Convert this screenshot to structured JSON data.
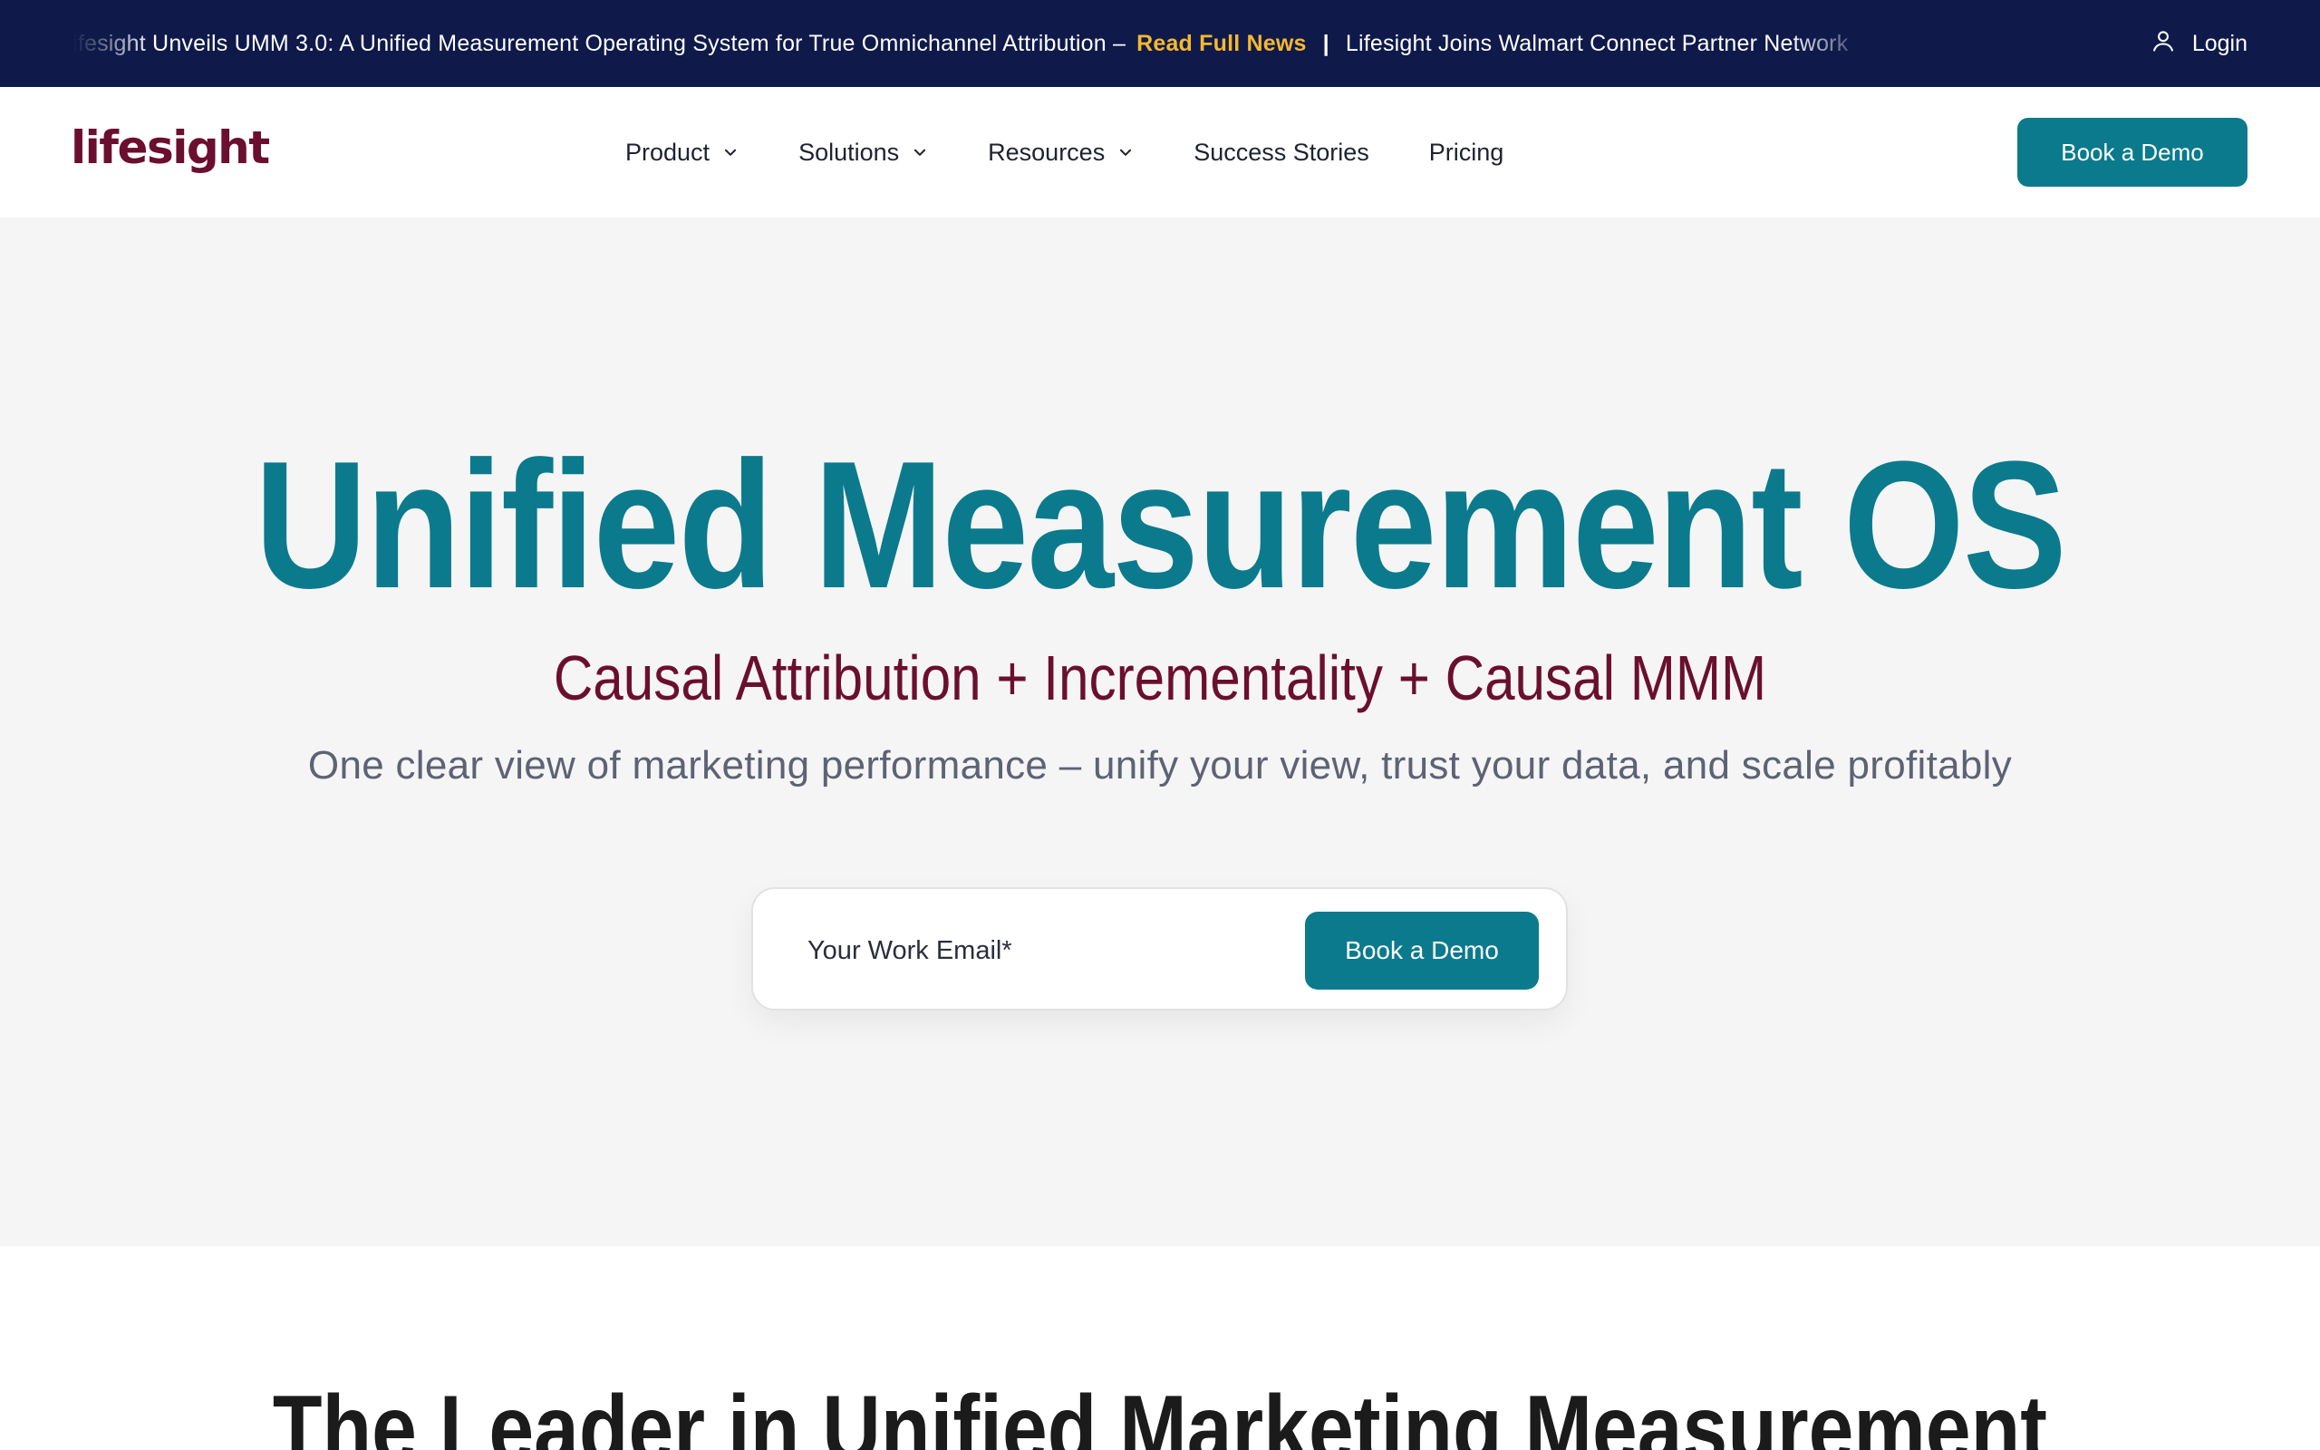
{
  "announcement": {
    "headline_1": "Lifesight Unveils UMM 3.0: A Unified Measurement Operating System for True Omnichannel Attribution –",
    "link_label": "Read Full News",
    "separator": "|",
    "headline_2": "Lifesight Joins Walmart Connect Partner Network",
    "login_label": "Login"
  },
  "nav": {
    "logo": "lifesight",
    "items": [
      {
        "label": "Product",
        "has_dropdown": true
      },
      {
        "label": "Solutions",
        "has_dropdown": true
      },
      {
        "label": "Resources",
        "has_dropdown": true
      },
      {
        "label": "Success Stories",
        "has_dropdown": false
      },
      {
        "label": "Pricing",
        "has_dropdown": false
      }
    ],
    "cta_label": "Book a Demo"
  },
  "hero": {
    "title": "Unified Measurement OS",
    "subtitle": "Causal Attribution + Incrementality + Causal MMM",
    "description": "One clear view of marketing performance – unify your view, trust your data, and scale profitably",
    "email_placeholder": "Your Work Email*",
    "cta_label": "Book a Demo"
  },
  "section2": {
    "title": "The Leader in Unified Marketing Measurement"
  },
  "colors": {
    "announcement_bg": "#0f1a4a",
    "link_accent": "#f5b82e",
    "brand_teal": "#0b7a8c",
    "brand_maroon": "#6b0f2e",
    "hero_bg": "#f5f5f5"
  },
  "icons": {
    "login": "user-icon",
    "dropdown": "chevron-down-icon"
  }
}
